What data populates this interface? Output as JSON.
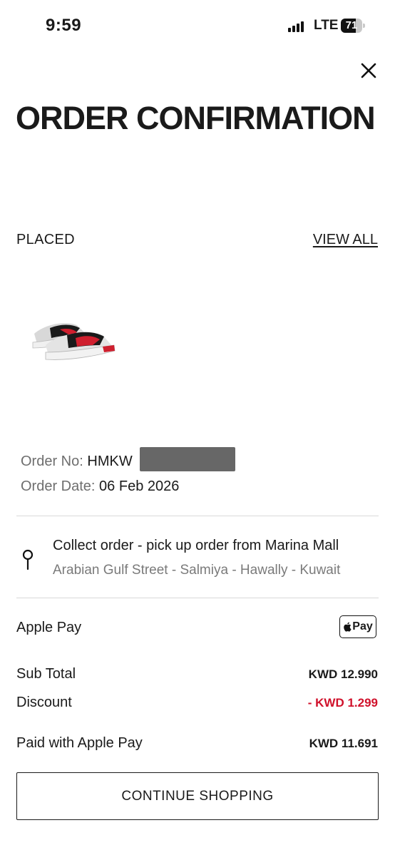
{
  "status_bar": {
    "time": "9:59",
    "network": "LTE",
    "battery": "71",
    "battery_level": 0.71
  },
  "header": {
    "title": "ORDER CONFIRMATION",
    "close_icon": "close-icon"
  },
  "order": {
    "status": "PLACED",
    "view_all_label": "VIEW ALL",
    "product_image": "sneaker-image",
    "number_label": "Order No:",
    "number_value": "HMKW",
    "date_label": "Order Date:",
    "date_value": "06 Feb 2026"
  },
  "pickup": {
    "icon": "map-pin-icon",
    "title": "Collect order - pick up order from Marina Mall",
    "address": "Arabian Gulf Street - Salmiya - Hawally - Kuwait"
  },
  "payment": {
    "method": "Apple Pay",
    "badge_text": "Pay",
    "badge_icon": "apple-icon",
    "subtotal_label": "Sub Total",
    "subtotal_value": "KWD 12.990",
    "discount_label": "Discount",
    "discount_value": "- KWD 1.299",
    "paid_label": "Paid with Apple Pay",
    "paid_value": "KWD 11.691",
    "discount_color": "#d0112b"
  },
  "cta": {
    "label": "CONTINUE SHOPPING"
  }
}
